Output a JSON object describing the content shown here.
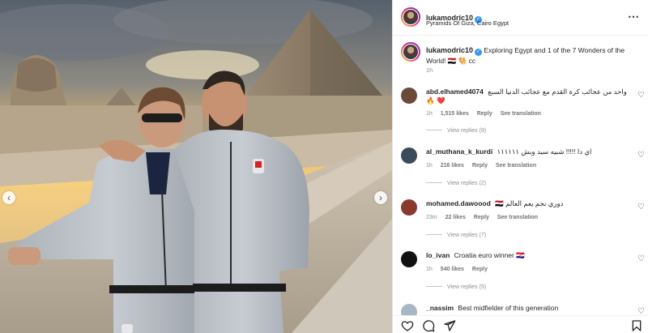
{
  "post": {
    "username": "lukamodric10",
    "location": "Pyramids Of Giza, Cairo Egypt",
    "caption": "Exploring Egypt and 1 of the 7 Wonders of the World! 🇪🇬 🐫 cc",
    "caption_time": "1h",
    "more_icon": "⋯"
  },
  "photo": {
    "nav_left_icon": "chevron-left",
    "nav_right_icon": "chevron-right"
  },
  "comments": [
    {
      "username": "abd.elhamed4074",
      "text": "واحد من عجائب كرة القدم مع عجائب الدنيا السبع 🔥 ❤️",
      "time": "1h",
      "likes": "1,515 likes",
      "reply": "Reply",
      "translation": "See translation",
      "replies": "View replies (9)",
      "avatar_color": "#6b4a3a"
    },
    {
      "username": "al_muthana_k_kurdi",
      "text": "اي دا !!!!! شبيه سيد وبش ١١١١١١",
      "time": "1h",
      "likes": "216 likes",
      "reply": "Reply",
      "translation": "See translation",
      "replies": "View replies (2)",
      "avatar_color": "#3b4b5c"
    },
    {
      "username": "mohamed.dawoood",
      "text": "🇪🇬 دوري نجم يعم العالم",
      "time": "23m",
      "likes": "22 likes",
      "reply": "Reply",
      "translation": "See translation",
      "replies": "View replies (7)",
      "avatar_color": "#8a3a2c"
    },
    {
      "username": "lo_ivan",
      "text": "Croatia euro winner 🇭🇷",
      "time": "1h",
      "likes": "540 likes",
      "reply": "Reply",
      "translation": "",
      "replies": "View replies (5)",
      "avatar_color": "#111111"
    },
    {
      "username": "_nassim",
      "text": "Best midfielder of this generation",
      "time": "",
      "likes": "",
      "reply": "",
      "translation": "",
      "replies": "",
      "avatar_color": "#a7b8c2"
    }
  ],
  "colors": {
    "verified": "#3897f0",
    "heart_red": "#ed4956",
    "meta_gray": "#8e8e8e"
  }
}
